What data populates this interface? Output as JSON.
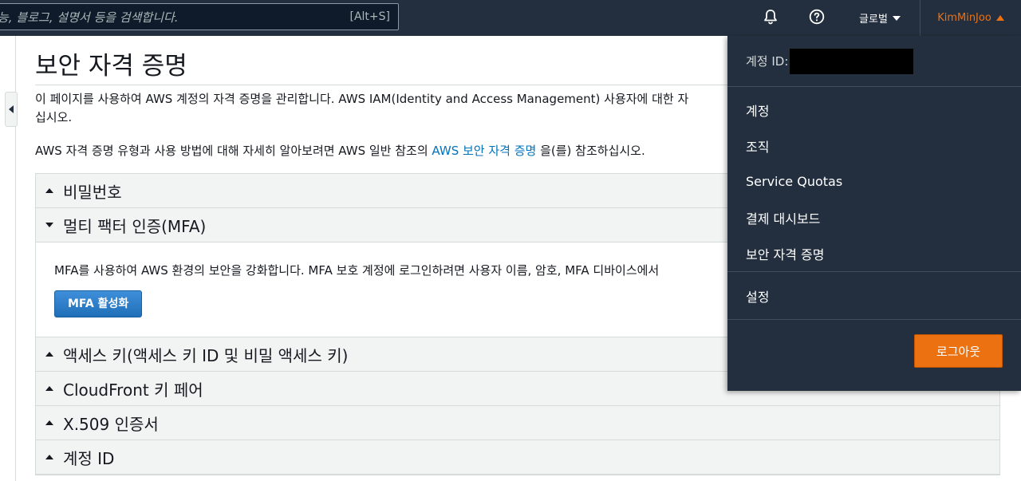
{
  "search": {
    "placeholder": "능, 블로그, 설명서 등을 검색합니다.",
    "shortcut": "[Alt+S]"
  },
  "nav": {
    "bell_icon": "bell-icon",
    "help_icon": "help-icon",
    "region_label": "글로벌",
    "account_label": "KimMinJoo"
  },
  "page": {
    "title": "보안 자격 증명",
    "intro": "이 페이지를 사용하여 AWS 계정의 자격 증명을 관리합니다. AWS IAM(Identity and Access Management) 사용자에 대한 자",
    "intro_cont": "십시오.",
    "ref_before": "AWS 자격 증명 유형과 사용 방법에 대해 자세히 알아보려면 AWS 일반 참조의 ",
    "ref_link": "AWS 보안 자격 증명",
    "ref_after": " 을(를) 참조하십시오."
  },
  "sections": [
    {
      "label": "비밀번호"
    },
    {
      "label": "멀티 팩터 인증(MFA)"
    },
    {
      "label": "액세스 키(액세스 키 ID 및 비밀 액세스 키)"
    },
    {
      "label": "CloudFront 키 페어"
    },
    {
      "label": "X.509 인증서"
    },
    {
      "label": "계정 ID"
    }
  ],
  "mfa": {
    "description": "MFA를 사용하여 AWS 환경의 보안을 강화합니다. MFA 보호 계정에 로그인하려면 사용자 이름, 암호, MFA 디바이스에서",
    "button": "MFA 활성화"
  },
  "dropdown": {
    "account_id_label": "계정 ID:",
    "items": [
      {
        "label": "계정"
      },
      {
        "label": "조직"
      },
      {
        "label": "Service Quotas"
      },
      {
        "label": "결제 대시보드"
      },
      {
        "label": "보안 자격 증명"
      }
    ],
    "settings": "설정",
    "logout": "로그아웃"
  },
  "colors": {
    "nav_bg": "#232f3e",
    "accent": "#ec7211",
    "link": "#0073bb",
    "primary_button": "#1f6fb8"
  }
}
